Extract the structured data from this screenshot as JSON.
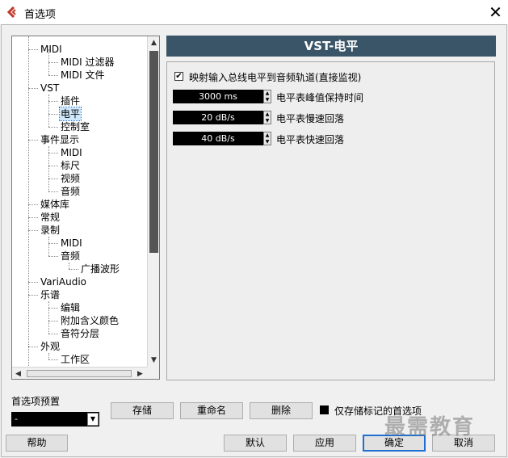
{
  "window": {
    "title": "首选项"
  },
  "tree": {
    "items": [
      {
        "label": "MIDI"
      },
      {
        "label": "MIDI 过滤器"
      },
      {
        "label": "MIDI 文件"
      },
      {
        "label": "VST"
      },
      {
        "label": "插件"
      },
      {
        "label": "电平"
      },
      {
        "label": "控制室"
      },
      {
        "label": "事件显示"
      },
      {
        "label": "MIDI"
      },
      {
        "label": "标尺"
      },
      {
        "label": "视频"
      },
      {
        "label": "音频"
      },
      {
        "label": "媒体库"
      },
      {
        "label": "常规"
      },
      {
        "label": "录制"
      },
      {
        "label": "MIDI"
      },
      {
        "label": "音频"
      },
      {
        "label": "广播波形"
      },
      {
        "label": "VariAudio"
      },
      {
        "label": "乐谱"
      },
      {
        "label": "编辑"
      },
      {
        "label": "附加含义颜色"
      },
      {
        "label": "音符分层"
      },
      {
        "label": "外观"
      },
      {
        "label": "工作区"
      }
    ],
    "selected": "电平"
  },
  "panel": {
    "title": "VST-电平",
    "checkbox": {
      "label": "映射输入总线电平到音频轨道(直接监视)",
      "checked": true
    },
    "settings": [
      {
        "value": "3000 ms",
        "label": "电平表峰值保持时间"
      },
      {
        "value": "20 dB/s",
        "label": "电平表慢速回落"
      },
      {
        "value": "40 dB/s",
        "label": "电平表快速回落"
      }
    ]
  },
  "presets": {
    "label": "首选项预置",
    "selected": "-",
    "store_label": "存储",
    "rename_label": "重命名",
    "delete_label": "删除",
    "only_marked_label": "仅存储标记的首选项"
  },
  "footer": {
    "help_label": "帮助",
    "default_label": "默认",
    "apply_label": "应用",
    "ok_label": "确定",
    "cancel_label": "取消"
  },
  "watermark": "最需教育",
  "colors": {
    "header_bg": "#3a5468",
    "selection_bg": "#cfe8fb",
    "field_bg": "#000000"
  }
}
